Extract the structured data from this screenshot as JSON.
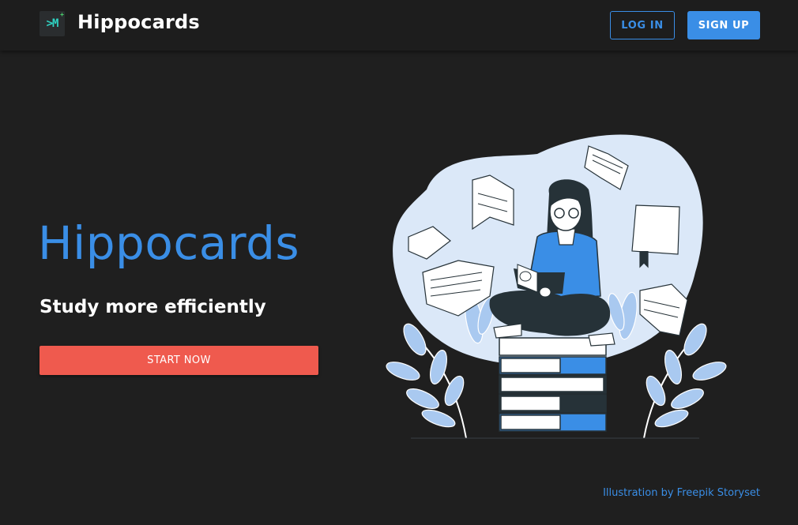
{
  "navbar": {
    "logo_text": ">M",
    "brand": "Hippocards",
    "login_label": "LOG IN",
    "signup_label": "SIGN UP"
  },
  "hero": {
    "title": "Hippocards",
    "subtitle": "Study more efficiently",
    "cta_label": "START NOW"
  },
  "illustration": {
    "icon": "woman-reading-on-books-illustration"
  },
  "footer": {
    "credit": "Illustration by Freepik Storyset"
  },
  "colors": {
    "background": "#1f1f1f",
    "navbar": "#1d1d1d",
    "accent_blue": "#3a8ee6",
    "cta_red": "#ef5a4e",
    "blob": "#dbe8f8"
  }
}
